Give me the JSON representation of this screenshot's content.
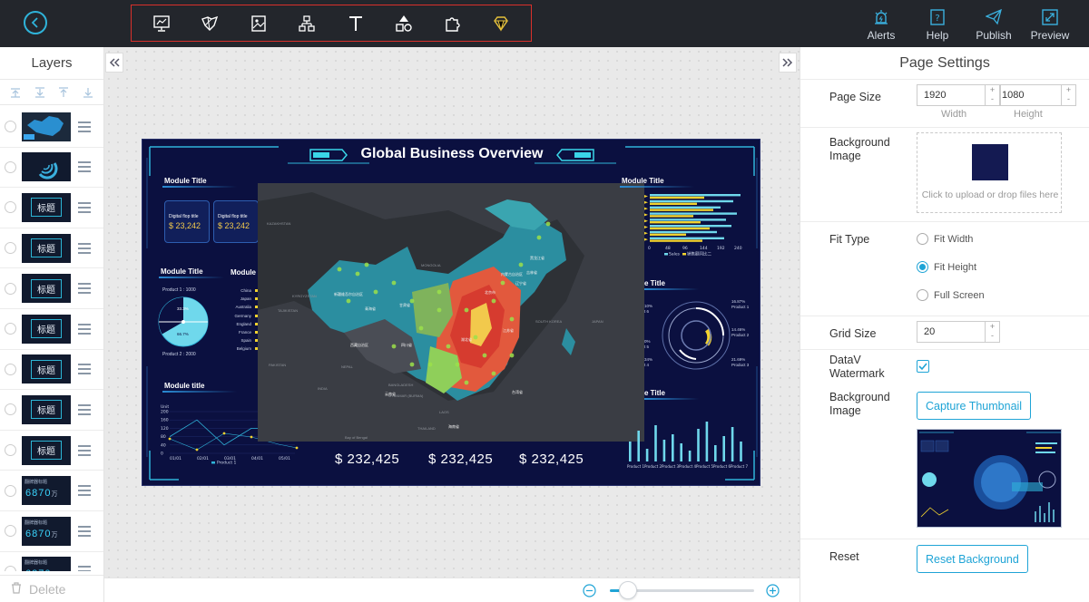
{
  "toolbar": {
    "back_icon": "back-arrow-icon",
    "tools": [
      "presentation-chart-icon",
      "map-icon",
      "media-icon",
      "hierarchy-icon",
      "text-icon",
      "shapes-icon",
      "puzzle-icon",
      "diamond-icon"
    ],
    "right": [
      {
        "icon": "alert-icon",
        "label": "Alerts"
      },
      {
        "icon": "help-icon",
        "label": "Help"
      },
      {
        "icon": "publish-icon",
        "label": "Publish"
      },
      {
        "icon": "preview-icon",
        "label": "Preview"
      }
    ]
  },
  "layers_panel": {
    "title": "Layers",
    "delete_label": "Delete",
    "layers": [
      {
        "type": "map"
      },
      {
        "type": "gauge"
      },
      {
        "type": "title",
        "text": "标题"
      },
      {
        "type": "title",
        "text": "标题"
      },
      {
        "type": "title",
        "text": "标题"
      },
      {
        "type": "title",
        "text": "标题"
      },
      {
        "type": "title",
        "text": "标题"
      },
      {
        "type": "title",
        "text": "标题"
      },
      {
        "type": "title",
        "text": "标题"
      },
      {
        "type": "number",
        "value": "6870",
        "unit": "万"
      },
      {
        "type": "number",
        "value": "6870",
        "unit": "万"
      },
      {
        "type": "number",
        "value": "6870",
        "unit": "万"
      }
    ]
  },
  "screen": {
    "title": "Global Business Overview",
    "module_titles": {
      "top_left": "Module Title",
      "mid_left": "Module Title",
      "mid_left2": "Module",
      "bottom_left": "Module title",
      "top_right": "Module Title",
      "mid_right": "e Title",
      "bottom_right": "e Title"
    },
    "flop_cards": [
      {
        "title": "Digital flop title",
        "value": "$ 23,242"
      },
      {
        "title": "Digital flop title",
        "value": "$ 23,242"
      }
    ],
    "pie": {
      "product1": "Product 1 : 1000",
      "product2": "Product 2 : 2000",
      "p1": "33.3%",
      "p2": "66.7%"
    },
    "countries": [
      "China",
      "Japan",
      "Australia",
      "Germany",
      "England",
      "France",
      "Spain",
      "Belgium"
    ],
    "money": [
      "$ 232,425",
      "$ 232,425",
      "$ 232,425"
    ],
    "line_x": [
      "01/01",
      "02/01",
      "03/01",
      "04/01",
      "05/01"
    ],
    "line_y": [
      "200",
      "160",
      "120",
      "80",
      "40",
      "0"
    ],
    "line_unit": "Unit",
    "line_legend": "Product 1",
    "bar_x": [
      "0",
      "48",
      "96",
      "144",
      "192",
      "240"
    ],
    "bar_legend": [
      "Sales",
      "销售额同比二"
    ],
    "ring_labels": [
      "16.87%",
      "Product 1",
      "14.46%",
      "Product 2",
      "21.69%",
      "Product 3"
    ],
    "ring_left": [
      "10%",
      "t 6",
      "0%",
      "t 5",
      "34%",
      "t 4"
    ],
    "col_x": [
      "Product 1",
      "Product 2",
      "Product 3",
      "Product 4",
      "Product 5",
      "Product 6",
      "Product 7"
    ],
    "map_labels": [
      "KAZAKHSTAN",
      "MONGOLIA",
      "KYRGYZSTAN",
      "TAJIKISTAN",
      "PAKISTAN",
      "NEPAL",
      "INDIA",
      "BANGLADESH",
      "MYANMAR (BURMA)",
      "LAOS",
      "THAILAND",
      "SOUTH KOREA",
      "JAPAN",
      "Bay of Bengal",
      "新疆维吾尔自治区",
      "西藏自治区",
      "甘肃省",
      "青海省",
      "内蒙古自治区",
      "黑龙江省",
      "吉林省",
      "辽宁省",
      "北京市",
      "四川省",
      "云南省",
      "台湾省",
      "海南省",
      "湖北省",
      "江苏省"
    ]
  },
  "page_settings": {
    "title": "Page Settings",
    "page_size_label": "Page Size",
    "width": "1920",
    "height": "1080",
    "width_label": "Width",
    "height_label": "Height",
    "bg_image_label": "Background Image",
    "upload_text": "Click to upload or drop files here",
    "fit_type_label": "Fit Type",
    "fit_options": [
      "Fit Width",
      "Fit Height",
      "Full Screen"
    ],
    "fit_selected": "Fit Height",
    "grid_size_label": "Grid Size",
    "grid_size": "20",
    "watermark_label": "DataV Watermark",
    "watermark_checked": true,
    "bg_image_label2": "Background Image",
    "capture_btn": "Capture Thumbnail",
    "reset_label": "Reset",
    "reset_btn": "Reset Background"
  },
  "colors": {
    "accent": "#1fa4d6",
    "topbar": "#23262c",
    "screen_bg": "#0b1040",
    "alert_red": "#d9302b"
  }
}
